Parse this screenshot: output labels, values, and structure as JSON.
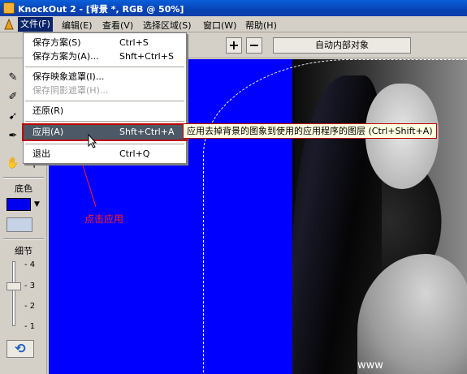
{
  "window": {
    "title": "KnockOut 2 - [背景 *, RGB @ 50%]"
  },
  "menubar": {
    "items": [
      "文件(F)",
      "编辑(E)",
      "查看(V)",
      "选择区域(S)",
      "窗口(W)",
      "帮助(H)"
    ]
  },
  "toolbar": {
    "plus": "+",
    "minus": "−",
    "auto_inner": "自动内部对象"
  },
  "file_menu": {
    "items": [
      {
        "label": "保存方案(S)",
        "shortcut": "Ctrl+S"
      },
      {
        "label": "保存方案为(A)...",
        "shortcut": "Shft+Ctrl+S"
      },
      {
        "label": "保存映象遮罩(I)...",
        "shortcut": ""
      },
      {
        "label": "保存阴影遮罩(H)...",
        "shortcut": ""
      },
      {
        "label": "还原(R)",
        "shortcut": ""
      },
      {
        "label": "应用(A)",
        "shortcut": "Shft+Ctrl+A"
      },
      {
        "label": "退出",
        "shortcut": "Ctrl+Q"
      }
    ]
  },
  "tooltip": "应用去掉背景的图象到使用的应用程序的图层 (Ctrl+Shift+A)",
  "annotation": "点击应用",
  "left_panel": {
    "bg_color_label": "底色",
    "bg_color": "#0000ee",
    "detail_label": "细节",
    "ticks": [
      "4",
      "3",
      "2",
      "1"
    ],
    "detail_value": 3
  },
  "watermark": "www"
}
